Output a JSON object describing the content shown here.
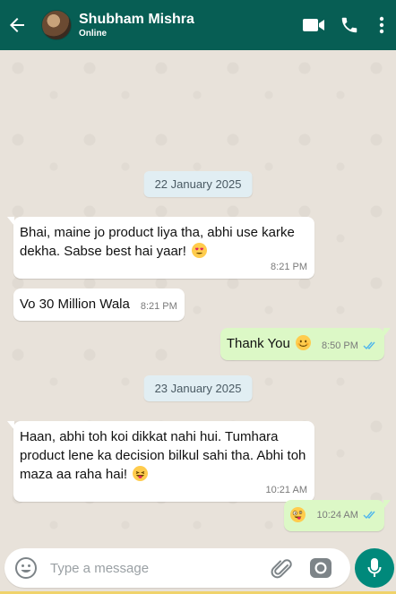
{
  "header": {
    "contact_name": "Shubham Mishra",
    "status": "Online",
    "icons": [
      "back-arrow-icon",
      "video-call-icon",
      "phone-icon",
      "more-vert-icon"
    ]
  },
  "messages": [
    {
      "type": "date",
      "text": "22 January 2025"
    },
    {
      "type": "in",
      "text": "Bhai, maine jo product liya tha, abhi use karke dekha. Sabse best hai yaar!",
      "emoji": "heart-eyes",
      "time": "8:21 PM"
    },
    {
      "type": "in",
      "text": "Vo 30 Million Wala",
      "time": "8:21 PM"
    },
    {
      "type": "out",
      "text": "Thank You",
      "emoji": "smiling-face",
      "time": "8:50 PM",
      "read": true
    },
    {
      "type": "date",
      "text": "23 January 2025"
    },
    {
      "type": "in",
      "text": "Haan, abhi toh koi dikkat nahi hui. Tumhara product lene ka decision bilkul sahi tha. Abhi toh maza aa raha hai!",
      "emoji": "tongue-out",
      "time": "10:21 AM"
    },
    {
      "type": "out",
      "text": "",
      "emoji": "zany-face",
      "time": "10:24 AM",
      "read": true
    }
  ],
  "input": {
    "placeholder": "Type a message",
    "icons": [
      "emoji-icon",
      "attach-icon",
      "camera-icon",
      "mic-icon"
    ]
  },
  "colors": {
    "header": "#075e54",
    "outgoing_bubble": "#dcf8c6",
    "incoming_bubble": "#ffffff",
    "date_chip": "#e1eef3",
    "read_ticks": "#4fb6ec",
    "mic_button": "#00897b"
  }
}
